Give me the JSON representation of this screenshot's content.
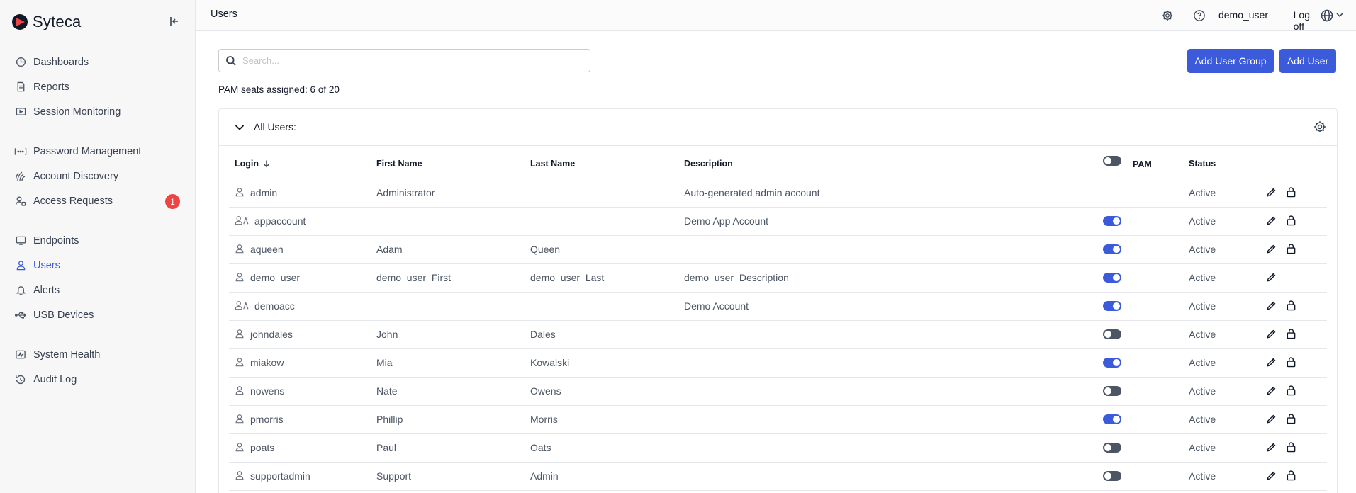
{
  "app": {
    "brand": "Syteca"
  },
  "sidebar": {
    "groups": [
      [
        {
          "label": "Dashboards",
          "icon": "dashboard-icon"
        },
        {
          "label": "Reports",
          "icon": "report-icon"
        },
        {
          "label": "Session Monitoring",
          "icon": "session-icon"
        }
      ],
      [
        {
          "label": "Password Management",
          "icon": "password-icon"
        },
        {
          "label": "Account Discovery",
          "icon": "discovery-icon"
        },
        {
          "label": "Access Requests",
          "icon": "access-icon",
          "badge": "1"
        }
      ],
      [
        {
          "label": "Endpoints",
          "icon": "monitor-icon"
        },
        {
          "label": "Users",
          "icon": "user-icon",
          "active": true
        },
        {
          "label": "Alerts",
          "icon": "bell-icon"
        },
        {
          "label": "USB Devices",
          "icon": "usb-icon"
        }
      ],
      [
        {
          "label": "System Health",
          "icon": "health-icon"
        },
        {
          "label": "Audit Log",
          "icon": "history-icon"
        }
      ]
    ]
  },
  "header": {
    "title": "Users",
    "username": "demo_user",
    "logoff": "Log off"
  },
  "toolbar": {
    "search_placeholder": "Search...",
    "add_group_label": "Add User Group",
    "add_user_label": "Add User",
    "seats_text": "PAM seats assigned: 6 of 20"
  },
  "panel": {
    "title": "All Users:",
    "columns": {
      "login": "Login",
      "first": "First Name",
      "last": "Last Name",
      "desc": "Description",
      "pam": "PAM",
      "status": "Status"
    }
  },
  "users": [
    {
      "login": "admin",
      "type": "user",
      "first": "Administrator",
      "last": "",
      "desc": "Auto-generated admin account",
      "pam": null,
      "status": "Active",
      "lock": true
    },
    {
      "login": "appaccount",
      "type": "app",
      "first": "",
      "last": "",
      "desc": "Demo App Account",
      "pam": true,
      "status": "Active",
      "lock": true
    },
    {
      "login": "aqueen",
      "type": "user",
      "first": "Adam",
      "last": "Queen",
      "desc": "",
      "pam": true,
      "status": "Active",
      "lock": true
    },
    {
      "login": "demo_user",
      "type": "user",
      "first": "demo_user_First",
      "last": "demo_user_Last",
      "desc": "demo_user_Description",
      "pam": true,
      "status": "Active",
      "lock": false
    },
    {
      "login": "demoacc",
      "type": "app",
      "first": "",
      "last": "",
      "desc": "Demo Account",
      "pam": true,
      "status": "Active",
      "lock": true
    },
    {
      "login": "johndales",
      "type": "user",
      "first": "John",
      "last": "Dales",
      "desc": "",
      "pam": false,
      "status": "Active",
      "lock": true
    },
    {
      "login": "miakow",
      "type": "user",
      "first": "Mia",
      "last": "Kowalski",
      "desc": "",
      "pam": true,
      "status": "Active",
      "lock": true
    },
    {
      "login": "nowens",
      "type": "user",
      "first": "Nate",
      "last": "Owens",
      "desc": "",
      "pam": false,
      "status": "Active",
      "lock": true
    },
    {
      "login": "pmorris",
      "type": "user",
      "first": "Phillip",
      "last": "Morris",
      "desc": "",
      "pam": true,
      "status": "Active",
      "lock": true
    },
    {
      "login": "poats",
      "type": "user",
      "first": "Paul",
      "last": "Oats",
      "desc": "",
      "pam": false,
      "status": "Active",
      "lock": true
    },
    {
      "login": "supportadmin",
      "type": "user",
      "first": "Support",
      "last": "Admin",
      "desc": "",
      "pam": false,
      "status": "Active",
      "lock": true
    }
  ],
  "colors": {
    "accent": "#3b5bdb",
    "badge": "#ef4444",
    "toggle_off": "#4b5563"
  }
}
